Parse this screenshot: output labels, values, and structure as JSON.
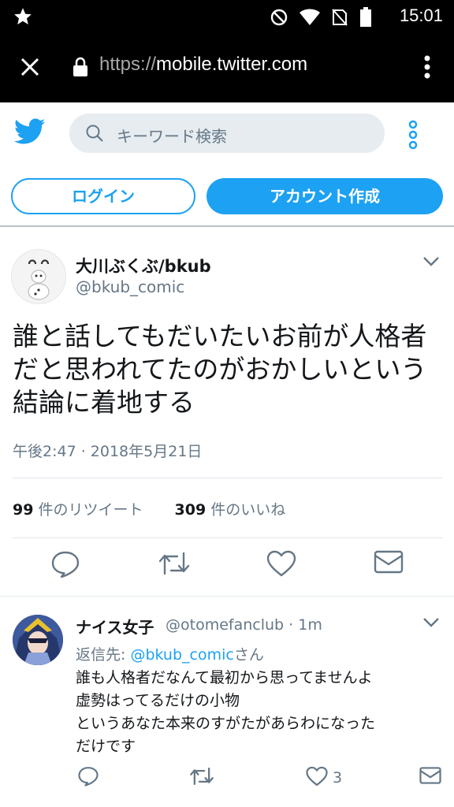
{
  "status_bar": {
    "time": "15:01"
  },
  "browser": {
    "url_proto": "https://",
    "url_host": "mobile.twitter.com"
  },
  "header": {
    "search_placeholder": "キーワード検索"
  },
  "buttons": {
    "login": "ログイン",
    "signup": "アカウント作成"
  },
  "tweet": {
    "name": "大川ぶくぶ/bkub",
    "handle": "@bkub_comic",
    "text_lines": [
      "誰と話してもだいたいお前が人格者",
      "だと思われてたのがおかしいという",
      "結論に着地する"
    ],
    "timestamp": "午後2:47 · 2018年5月21日",
    "retweets_count": "99",
    "retweets_label": "件のリツイート",
    "likes_count": "309",
    "likes_label": "件のいいね"
  },
  "reply": {
    "name": "ナイス女子",
    "handle": "@otomefanclub",
    "time": " · 1m",
    "reply_to_prefix": "返信先: ",
    "reply_to_mention": "@bkub_comic",
    "reply_to_suffix": "さん",
    "text_lines": [
      "誰も人格者だなんて最初から思ってませんよ",
      "虚勢はってるだけの小物",
      "というあなた本来のすがたがあらわになった",
      "だけです"
    ],
    "like_count": "3"
  },
  "colors": {
    "accent": "#1da1f2",
    "muted": "#657786",
    "search_bg": "#e6ecf0"
  }
}
